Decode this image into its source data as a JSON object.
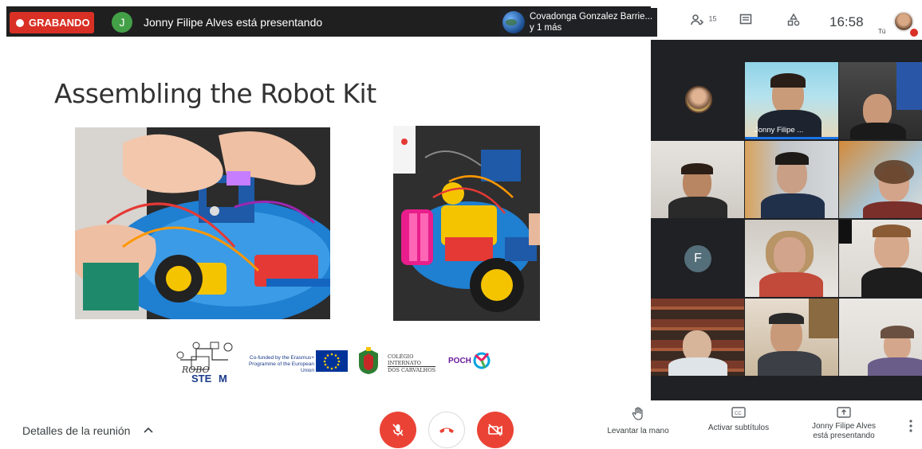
{
  "recording": {
    "label": "GRABANDO"
  },
  "presenter": {
    "initial": "J",
    "status_text": "Jonny Filipe Alves está presentando"
  },
  "active_speaker": {
    "name": "Covadonga Gonzalez Barrie...",
    "others": "y 1 más"
  },
  "top_controls": {
    "people_count": "15",
    "time": "16:58",
    "self_label": "Tú"
  },
  "slide": {
    "title": "Assembling the Robot Kit",
    "logos": {
      "robo_steam_1": "ROBO",
      "robo_steam_2": "STE",
      "robo_steam_3": "M",
      "erasmus_text": "Co-funded by the Erasmus+ Programme of the European Union",
      "colegio_1": "COLÉGIO",
      "colegio_2": "INTERNATO",
      "colegio_3": "DOS CARVALHOS",
      "poch": "POCH"
    }
  },
  "participants": [
    {
      "name": ""
    },
    {
      "name": "Jonny Filipe ..."
    },
    {
      "name": ""
    },
    {
      "name": ""
    },
    {
      "name": ""
    },
    {
      "name": ""
    },
    {
      "name": "",
      "initial": "F"
    },
    {
      "name": ""
    },
    {
      "name": ""
    },
    {
      "name": ""
    },
    {
      "name": ""
    },
    {
      "name": ""
    }
  ],
  "bottom": {
    "details": "Detalles de la reunión",
    "raise_hand": "Levantar la mano",
    "captions": "Activar subtítulos",
    "presenting_1": "Jonny Filipe Alves",
    "presenting_2": "está presentando"
  },
  "colors": {
    "red": "#ea4335",
    "dark": "#202124",
    "green": "#43a047"
  }
}
